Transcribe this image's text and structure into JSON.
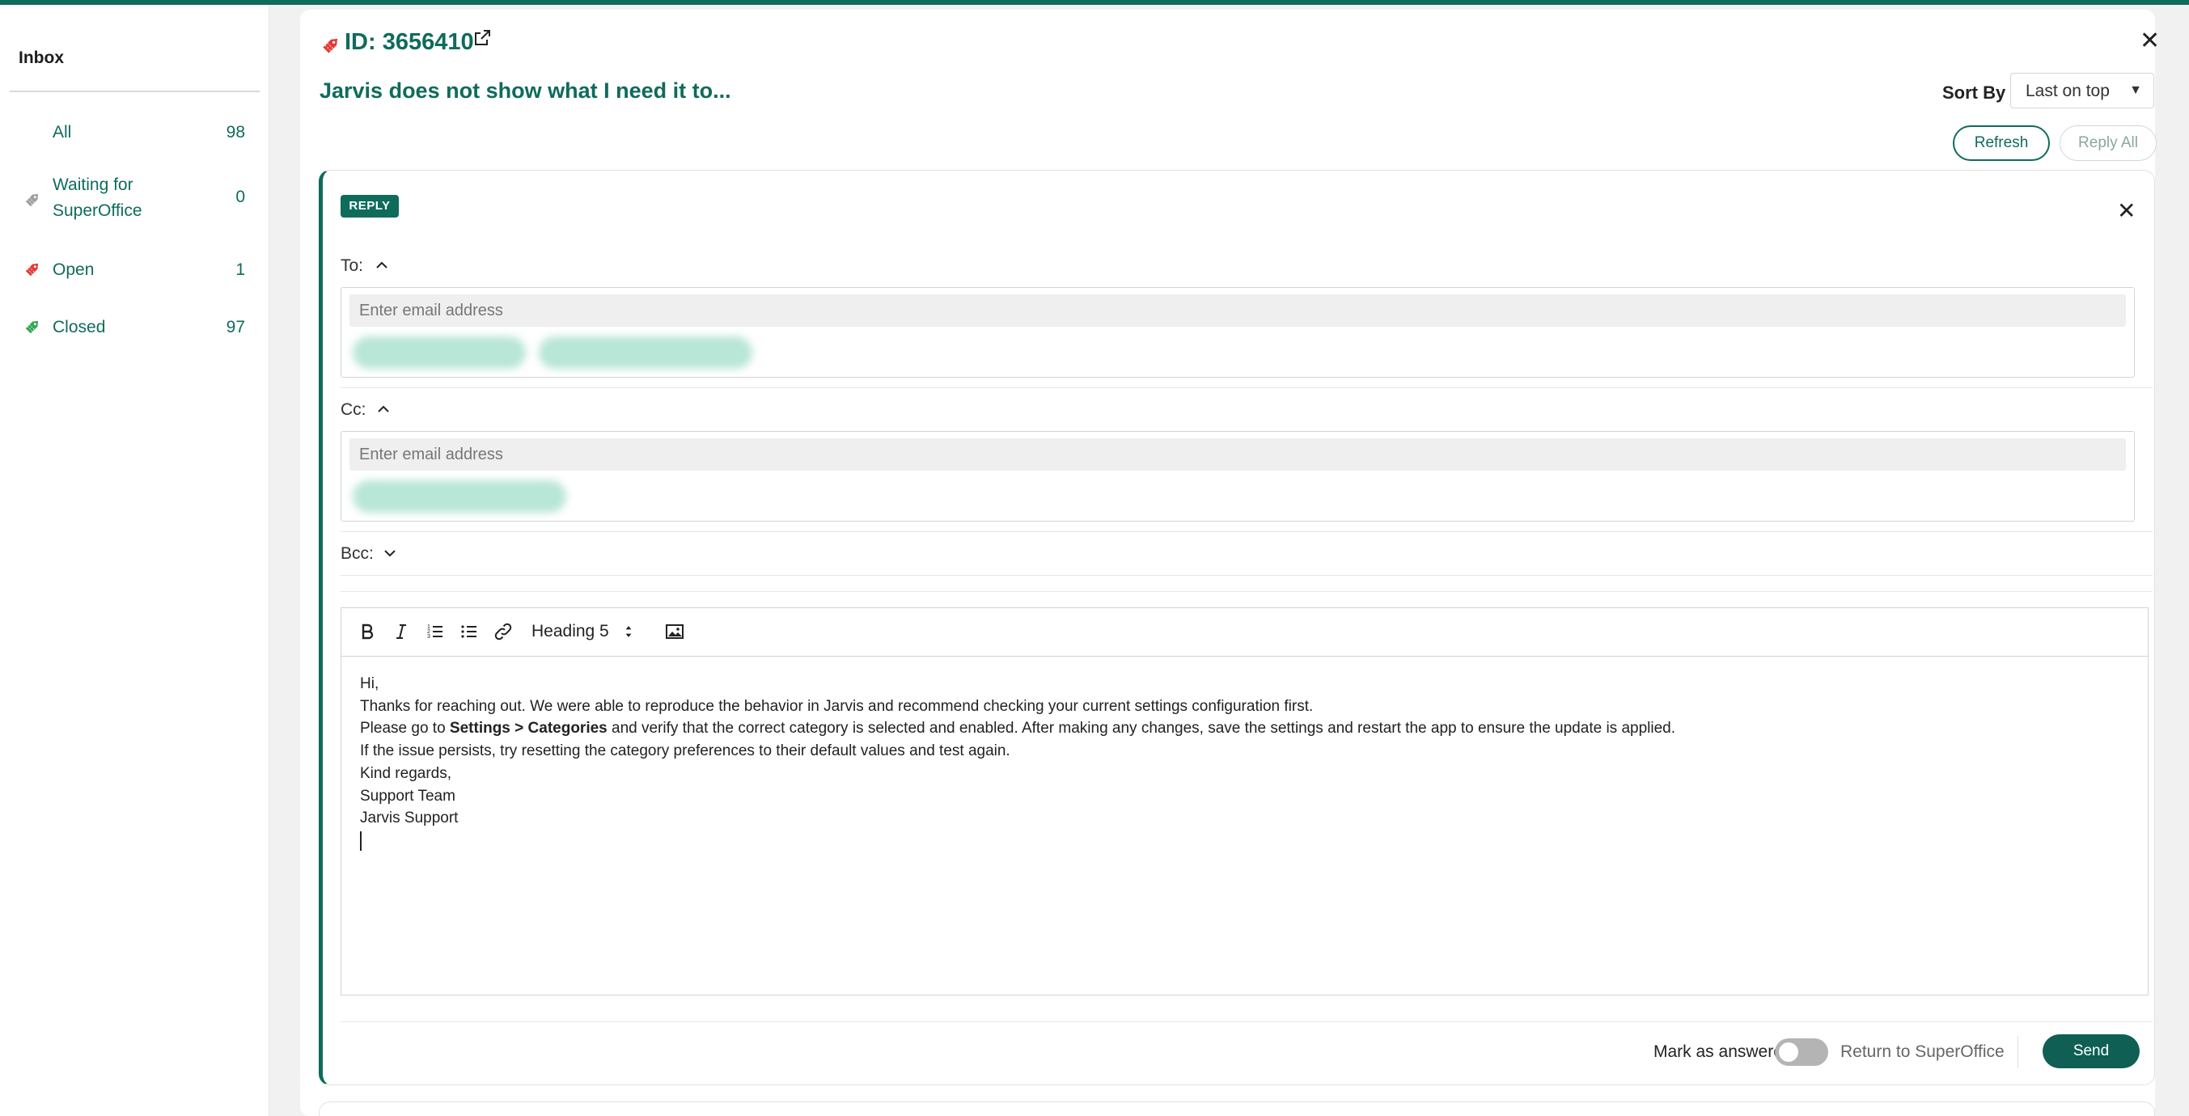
{
  "sidebar": {
    "title": "Inbox",
    "items": [
      {
        "label": "All",
        "count": "98",
        "icon": "none"
      },
      {
        "label_line1": "Waiting for",
        "label_line2": "SuperOffice",
        "count": "0",
        "icon": "tag-icon-grey"
      },
      {
        "label": "Open",
        "count": "1",
        "icon": "tag-icon-red"
      },
      {
        "label": "Closed",
        "count": "97",
        "icon": "tag-icon-green"
      }
    ]
  },
  "ticket": {
    "id_label": "ID: 3656410",
    "title": "Jarvis does not show what I need it to..."
  },
  "sort": {
    "label": "Sort By :",
    "value": "Last on top"
  },
  "actions": {
    "refresh": "Refresh",
    "reply_all": "Reply All"
  },
  "reply": {
    "badge": "REPLY",
    "to_label": "To:",
    "cc_label": "Cc:",
    "bcc_label": "Bcc:",
    "email_placeholder": "Enter email address",
    "heading_select": "Heading 5",
    "body": {
      "line1": "Hi,",
      "line2": "Thanks for reaching out. We were able to reproduce the behavior in Jarvis and recommend checking your current settings configuration first.",
      "line3_pre": "Please go to ",
      "line3_bold": "Settings > Categories",
      "line3_post": " and verify that the correct category is selected and enabled. After making any changes, save the settings and restart the app to ensure the update is applied.",
      "line4": "If the issue persists, try resetting the category preferences to their default values and test again.",
      "line5": "Kind regards,",
      "line6": "Support Team",
      "line7": "Jarvis Support"
    },
    "mark_as_answered": "Mark as answered",
    "return_label": "Return to SuperOffice",
    "send": "Send"
  },
  "colors": {
    "brand": "#0f6b5c",
    "open": "#e53935",
    "closed": "#2ea84f",
    "waiting": "#9e9e9e"
  }
}
